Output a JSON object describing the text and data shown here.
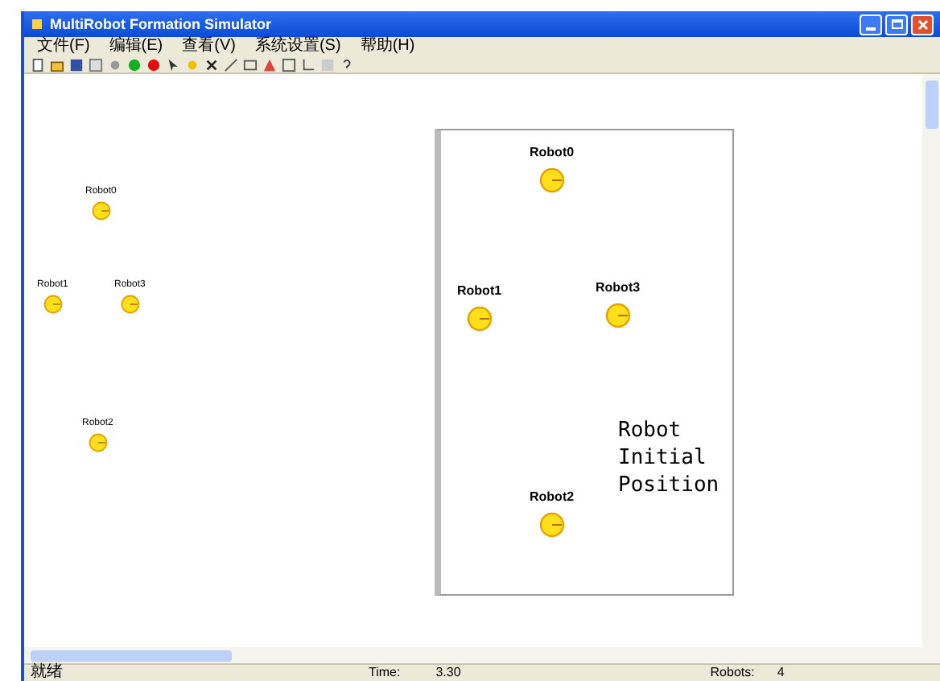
{
  "window": {
    "title": "MultiRobot Formation Simulator"
  },
  "menu": [
    "文件(F)",
    "编辑(E)",
    "查看(V)",
    "系统设置(S)",
    "帮助(H)"
  ],
  "canvas": {
    "robots": [
      {
        "label": "Robot0"
      },
      {
        "label": "Robot1"
      },
      {
        "label": "Robot3"
      },
      {
        "label": "Robot2"
      }
    ],
    "frame": {
      "robots": [
        {
          "label": "Robot0"
        },
        {
          "label": "Robot1"
        },
        {
          "label": "Robot3"
        },
        {
          "label": "Robot2"
        }
      ],
      "caption": [
        "Robot",
        "Initial",
        "Position"
      ]
    }
  },
  "status_bar": {
    "message": "就绪",
    "time_label": "Time:",
    "time_value": "3.30",
    "robots_label": "Robots:",
    "robots_value": "4"
  }
}
